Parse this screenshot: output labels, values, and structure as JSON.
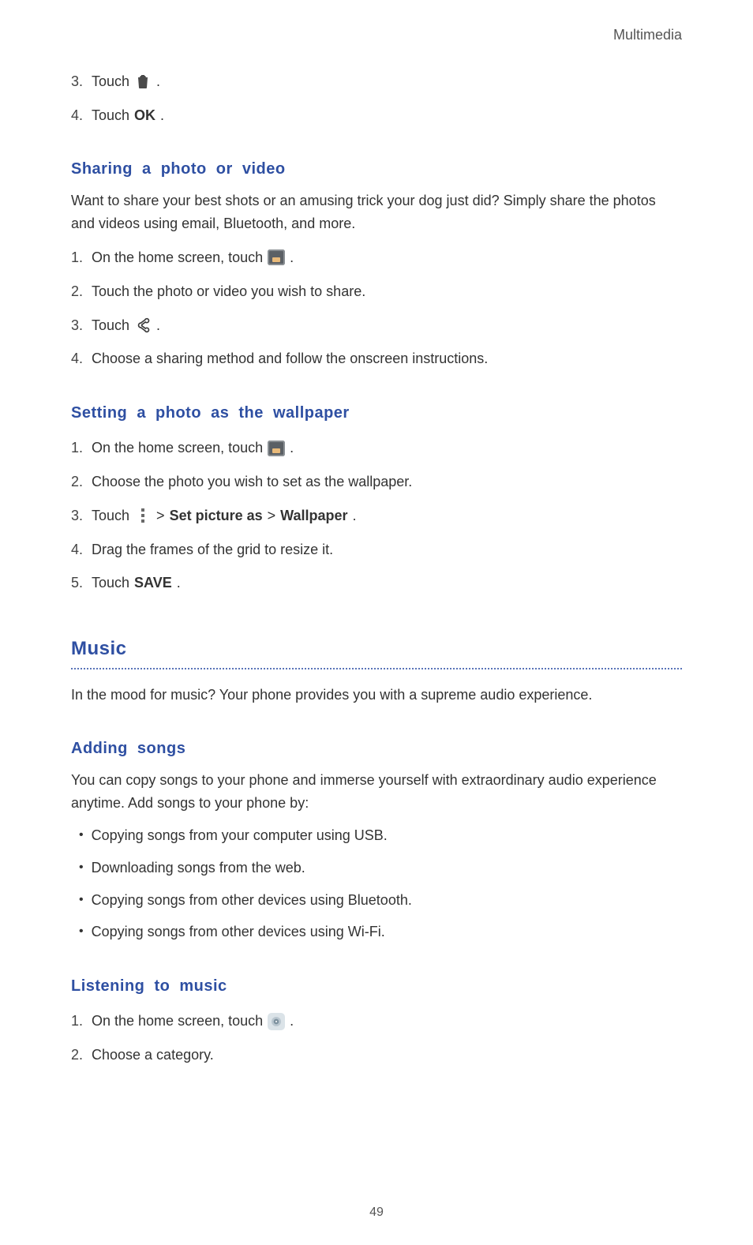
{
  "header": {
    "right": "Multimedia"
  },
  "topSteps": [
    {
      "marker": "3.",
      "pre": "Touch ",
      "icon": "trash",
      "post": " ."
    },
    {
      "marker": "4.",
      "pre": "Touch ",
      "bold": "OK",
      "post": "."
    }
  ],
  "sharing": {
    "heading": "Sharing a photo or video",
    "intro": "Want to share your best shots or an amusing trick your dog just did? Simply share the photos and videos using email, Bluetooth, and more.",
    "steps": [
      {
        "marker": "1.",
        "pre": "On the home screen, touch ",
        "icon": "gallery",
        "post": " ."
      },
      {
        "marker": "2.",
        "pre": "Touch the photo or video you wish to share."
      },
      {
        "marker": "3.",
        "pre": "Touch ",
        "icon": "share",
        "post": " ."
      },
      {
        "marker": "4.",
        "pre": "Choose a sharing method and follow the onscreen instructions."
      }
    ]
  },
  "wallpaper": {
    "heading": "Setting a photo as the wallpaper",
    "steps": [
      {
        "marker": "1.",
        "pre": "On the home screen, touch ",
        "icon": "gallery",
        "post": " ."
      },
      {
        "marker": "2.",
        "pre": "Choose the photo you wish to set as the wallpaper."
      },
      {
        "marker": "3.",
        "pre": "Touch ",
        "icon": "more",
        "mid1": " > ",
        "bold1": "Set picture as",
        "mid2": " > ",
        "bold2": "Wallpaper",
        "post": "."
      },
      {
        "marker": "4.",
        "pre": "Drag the frames of the grid to resize it."
      },
      {
        "marker": "5.",
        "pre": "Touch ",
        "bold": "SAVE",
        "post": "."
      }
    ]
  },
  "music": {
    "heading": "Music",
    "intro": "In the mood for music? Your phone provides you with a supreme audio experience.",
    "addingHeading": "Adding songs",
    "addingIntro": "You can copy songs to your phone and immerse yourself with extraordinary audio experience anytime. Add songs to your phone by:",
    "bullets": [
      "Copying songs from your computer using USB.",
      "Downloading songs from the web.",
      "Copying songs from other devices using Bluetooth.",
      "Copying songs from other devices using Wi-Fi."
    ],
    "listeningHeading": "Listening to music",
    "listeningSteps": [
      {
        "marker": "1.",
        "pre": "On the home screen, touch ",
        "icon": "music",
        "post": " ."
      },
      {
        "marker": "2.",
        "pre": "Choose a category."
      }
    ]
  },
  "pageNumber": "49"
}
